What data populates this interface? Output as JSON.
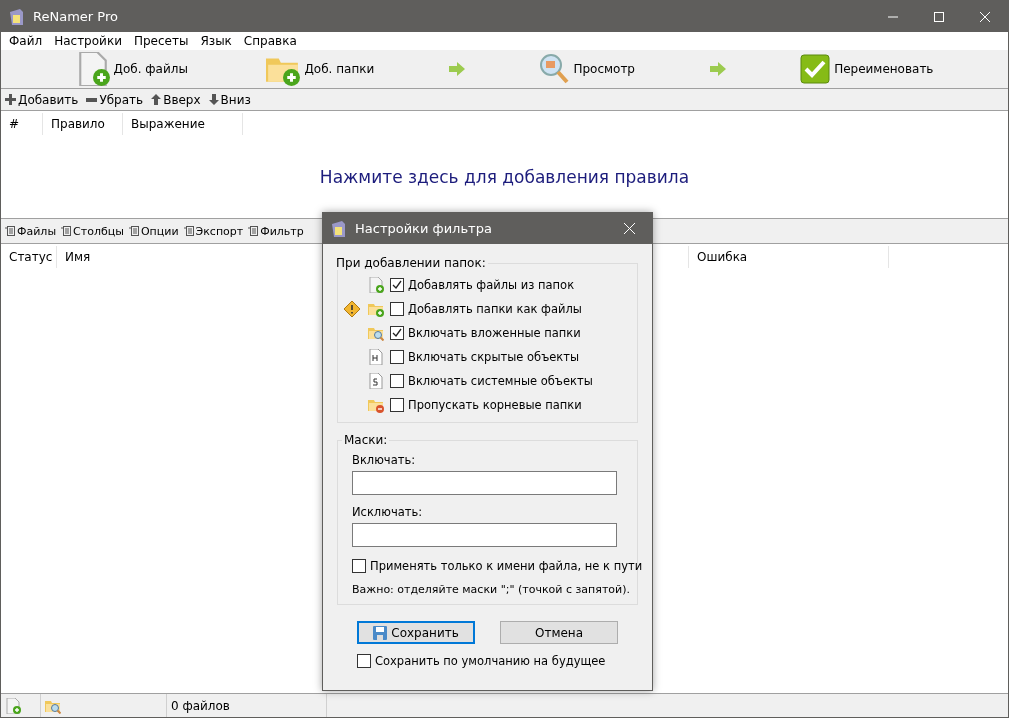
{
  "window": {
    "title": "ReNamer Pro"
  },
  "menu": [
    "Файл",
    "Настройки",
    "Пресеты",
    "Язык",
    "Справка"
  ],
  "toolbar": [
    {
      "kind": "files",
      "label": "Доб. файлы"
    },
    {
      "kind": "folders",
      "label": "Доб. папки"
    },
    {
      "kind": "preview",
      "label": "Просмотр"
    },
    {
      "kind": "rename",
      "label": "Переименовать"
    }
  ],
  "rules_toolbar": [
    {
      "kind": "plus",
      "label": "Добавить"
    },
    {
      "kind": "minus",
      "label": "Убрать"
    },
    {
      "kind": "up",
      "label": "Вверх"
    },
    {
      "kind": "down",
      "label": "Вниз"
    }
  ],
  "rules_table": {
    "columns": [
      "#",
      "Правило",
      "Выражение"
    ],
    "hint": "Нажмите здесь для добавления правила"
  },
  "files_toolbar": [
    "Файлы",
    "Столбцы",
    "Опции",
    "Экспорт",
    "Фильтр"
  ],
  "files_table": {
    "columns": [
      "Статус",
      "Имя",
      "Ошибка"
    ]
  },
  "status_bar": {
    "count": "0 файлов"
  },
  "dialog": {
    "title": "Настройки фильтра",
    "folders_group": {
      "title": "При добавлении папок:",
      "options": [
        {
          "kind": "file-add",
          "label": "Добавлять файлы из папок",
          "checked": true,
          "warning": false
        },
        {
          "kind": "folder-add",
          "label": "Добавлять папки как файлы",
          "checked": false,
          "warning": true
        },
        {
          "kind": "folder-search",
          "label": "Включать вложенные папки",
          "checked": true,
          "warning": false
        },
        {
          "kind": "hidden",
          "label": "Включать скрытые объекты",
          "checked": false,
          "warning": false
        },
        {
          "kind": "system",
          "label": "Включать системные объекты",
          "checked": false,
          "warning": false
        },
        {
          "kind": "folder-skip",
          "label": "Пропускать корневые папки",
          "checked": false,
          "warning": false
        }
      ]
    },
    "masks_group": {
      "title": "Маски:",
      "include_label": "Включать:",
      "exclude_label": "Исключать:",
      "filename_only": {
        "label": "Применять только к имени файла, не к пути",
        "checked": false
      },
      "note": "Важно: отделяйте маски \";\" (точкой с запятой)."
    },
    "save_button": "Сохранить",
    "cancel_button": "Отмена",
    "default_option": {
      "label": "Сохранить по умолчанию на будущее",
      "checked": false
    }
  }
}
